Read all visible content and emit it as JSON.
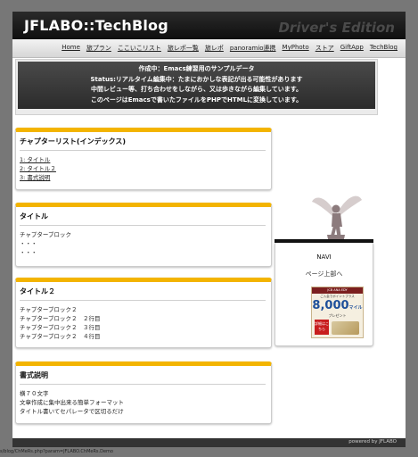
{
  "header": {
    "site_title": "JFLABO::TechBlog",
    "edition": "Driver's Edition"
  },
  "nav": {
    "items": [
      "Home",
      "旅プラン",
      "ここいこリスト",
      "旅レポ一覧",
      "旅レポ",
      "panoramio連携",
      "MyPhoto",
      "ストア",
      "GiftApp",
      "TechBlog"
    ]
  },
  "notice": {
    "lines": [
      "作成中：Emacs練習用のサンプルデータ",
      "Status:リアルタイム編集中：たまにおかしな表記が出る可能性があります",
      "中間レビュー等、打ち合わせをしながら、又は歩きながら編集しています。",
      "このページはEmacsで書いたファイルをPHPでHTMLに変換しています。"
    ]
  },
  "sections": {
    "index": {
      "title": "チャプターリスト(インデックス)",
      "links": [
        "1: タイトル",
        "2: タイトル２",
        "3: 書式説明"
      ]
    },
    "title1": {
      "title": "タイトル",
      "lines": [
        "チャプターブロック",
        "・・・",
        "・・・"
      ]
    },
    "title2": {
      "title": "タイトル２",
      "lines": [
        "チャプターブロック２",
        "チャプターブロック２　２行目",
        "チャプターブロック２　３行目",
        "チャプターブロック２　４行目"
      ]
    },
    "format": {
      "title": "書式説明",
      "lines": [
        "横７０文字",
        "文章作成に集中出来る簡単フォーマット",
        "タイトル書いてセパレータで区切るだけ"
      ]
    }
  },
  "sidebar": {
    "navi_label": "NAVI",
    "page_top_link": "ページ上部へ",
    "banner": {
      "top_text": "JCB ANA EDY",
      "sub_text": "ご入会でポイントプラス",
      "amount": "8,000",
      "unit": "マイル",
      "gift": "プレゼント",
      "button": "詳細はこちら"
    }
  },
  "footer": {
    "text": "powered by JFLABO"
  },
  "statusbar": {
    "url": "s/blog/ChMeRs.php?param=JFLABO.ChMeRs.Demo"
  },
  "colors": {
    "accent": "#f3b400",
    "header_bg": "#1a1a1a",
    "page_bg": "#777777"
  }
}
